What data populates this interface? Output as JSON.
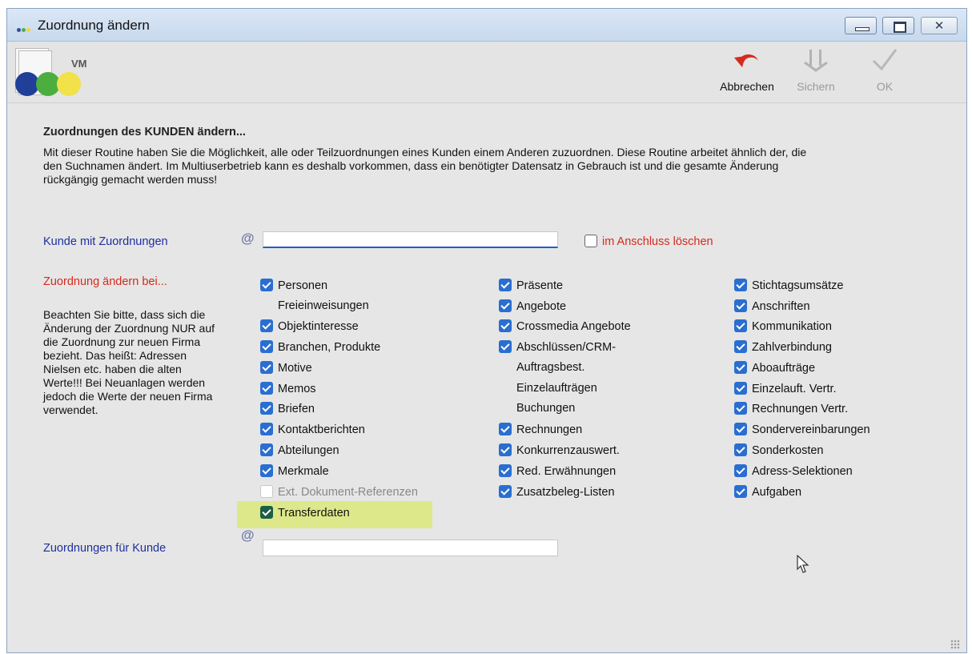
{
  "window": {
    "title": "Zuordnung ändern",
    "minimize_glyph": "",
    "maximize_glyph": "",
    "close_glyph": "✕"
  },
  "logo": {
    "text": "VM"
  },
  "toolbar": {
    "cancel_label": "Abbrechen",
    "save_label": "Sichern",
    "ok_label": "OK",
    "cancel_icon": "undo-arrow-icon",
    "save_icon": "save-arrows-icon",
    "ok_icon": "checkmark-icon"
  },
  "main": {
    "heading": "Zuordnungen des KUNDEN ändern...",
    "description": "Mit dieser Routine haben Sie die Möglichkeit, alle oder Teilzuordnungen eines Kunden einem Anderen zuzuordnen. Diese Routine arbeitet ähnlich der, die den Suchnamen ändert. Im Multiuserbetrieb kann es deshalb vorkommen, dass ein benötigter Datensatz in Gebrauch ist und die gesamte Änderung rückgängig gemacht werden muss!",
    "kunde_label": "Kunde mit Zuordnungen",
    "kunde_value": "",
    "delete_after_label": "im Anschluss löschen",
    "change_at_label": "Zuordnung ändern bei...",
    "note": "Beachten Sie bitte, dass sich die Änderung der Zuordnung NUR auf die Zuordnung zur neuen Firma bezieht. Das heißt: Adressen Nielsen etc. haben die alten Werte!!! Bei Neuanlagen werden jedoch die Werte der neuen Firma verwendet.",
    "target_label": "Zuordnungen für Kunde",
    "target_value": "",
    "at_symbol": "@"
  },
  "checkboxes": {
    "col1": [
      "Personen",
      "Freieinweisungen",
      "Objektinteresse",
      "Branchen, Produkte",
      "Motive",
      "Memos",
      "Briefen",
      "Kontaktberichten",
      "Abteilungen",
      "Merkmale",
      "Ext. Dokument-Referenzen",
      "Transferdaten"
    ],
    "col2": [
      "Präsente",
      "Angebote",
      "Crossmedia Angebote",
      "Abschlüssen/CRM-",
      "Auftragsbest.",
      "Einzelaufträgen",
      "Buchungen",
      "Rechnungen",
      "Konkurrenzauswert.",
      "Red. Erwähnungen",
      "Zusatzbeleg-Listen"
    ],
    "col3": [
      "Stichtagsumsätze",
      "Anschriften",
      "Kommunikation",
      "Zahlverbindung",
      "Aboaufträge",
      "Einzelauft. Vertr.",
      "Rechnungen Vertr.",
      "Sondervereinbarungen",
      "Sonderkosten",
      "Adress-Selektionen",
      "Aufgaben"
    ]
  },
  "colors": {
    "checkbox_blue": "#2a6ed0",
    "label_blue": "#1f2f9e",
    "label_red": "#d42a1e",
    "highlight": "#dde88a"
  }
}
